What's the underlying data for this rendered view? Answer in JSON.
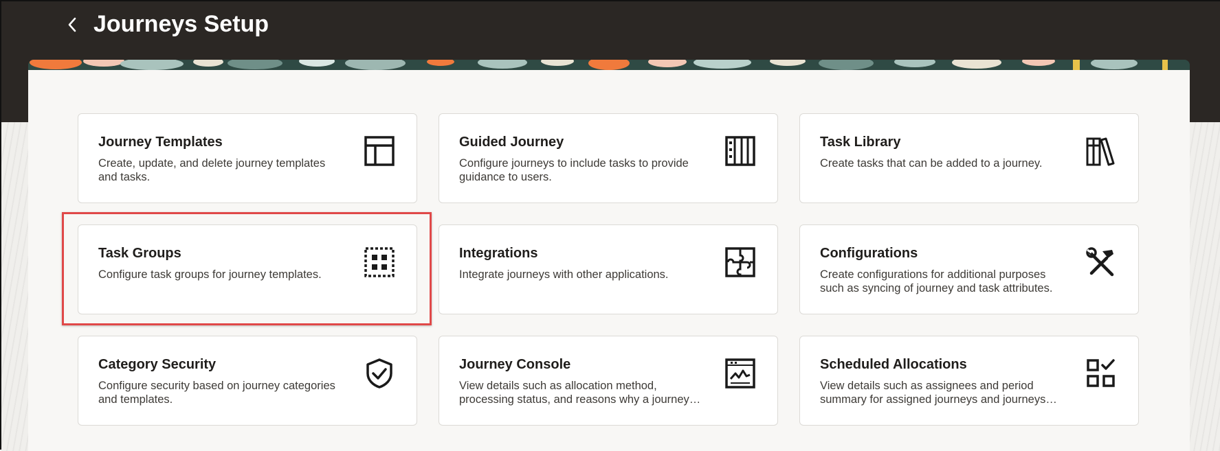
{
  "header": {
    "title": "Journeys Setup",
    "back_icon": "chevron-left-icon"
  },
  "cards": [
    {
      "title": "Journey Templates",
      "description": "Create, update, and delete journey templates and tasks.",
      "icon": "template-layout-icon"
    },
    {
      "title": "Guided Journey",
      "description": "Configure journeys to include tasks to provide guidance to users.",
      "icon": "columns-icon"
    },
    {
      "title": "Task Library",
      "description": "Create tasks that can be added to a journey.",
      "icon": "library-books-icon"
    },
    {
      "title": "Task Groups",
      "description": "Configure task groups for journey templates.",
      "icon": "dotted-grid-icon"
    },
    {
      "title": "Integrations",
      "description": "Integrate journeys with other applications.",
      "icon": "puzzle-icon"
    },
    {
      "title": "Configurations",
      "description": "Create configurations for additional purposes such as syncing of journey and task attributes.",
      "icon": "wrench-hammer-icon"
    },
    {
      "title": "Category Security",
      "description": "Configure security based on journey categories and templates.",
      "icon": "shield-check-icon"
    },
    {
      "title": "Journey Console",
      "description": "View details such as allocation method, processing status, and reasons why a journey…",
      "icon": "console-chart-icon"
    },
    {
      "title": "Scheduled Allocations",
      "description": "View details such as assignees and period summary for assigned journeys and journeys…",
      "icon": "checklist-grid-icon"
    }
  ],
  "highlighted_card": "Task Groups",
  "colors": {
    "header_bg": "#2b2724",
    "panel_bg": "#f8f7f5",
    "card_border": "#dcdad6",
    "highlight": "#e04848"
  }
}
